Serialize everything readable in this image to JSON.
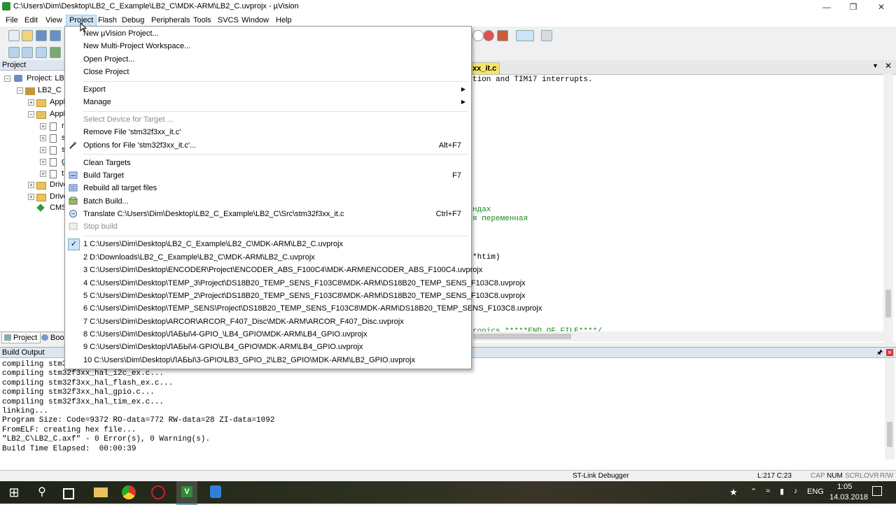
{
  "window": {
    "title": "C:\\Users\\Dim\\Desktop\\LB2_C_Example\\LB2_C\\MDK-ARM\\LB2_C.uvprojx - µVision"
  },
  "menubar": [
    "File",
    "Edit",
    "View",
    "Project",
    "Flash",
    "Debug",
    "Peripherals",
    "Tools",
    "SVCS",
    "Window",
    "Help"
  ],
  "project_pane": {
    "header": "Project",
    "tree": [
      "Project: LB2_",
      "LB2_C",
      "Appl",
      "Appl",
      "r",
      "s",
      "s",
      "g",
      "t",
      "Drive",
      "Drive",
      "CMS"
    ],
    "tabs": [
      "Project",
      "Boo"
    ]
  },
  "editor": {
    "tab": "xx_it.c",
    "lines": [
      {
        "text": "tion and TIM17 interrupts.",
        "color": "black"
      },
      {
        "text": "ндах",
        "color": "green"
      },
      {
        "text": "я переменная",
        "color": "green"
      },
      {
        "text": "*htim)",
        "color": "black"
      },
      {
        "text": "ronics *****END OF FILE****/",
        "color": "green"
      }
    ]
  },
  "project_menu": {
    "items": [
      {
        "label": "New µVision Project...",
        "shortcut": "",
        "enabled": true
      },
      {
        "label": "New Multi-Project Workspace...",
        "shortcut": "",
        "enabled": true
      },
      {
        "label": "Open Project...",
        "shortcut": "",
        "enabled": true
      },
      {
        "label": "Close Project",
        "shortcut": "",
        "enabled": true
      },
      {
        "label": "Export",
        "shortcut": "",
        "enabled": true,
        "submenu": true
      },
      {
        "label": "Manage",
        "shortcut": "",
        "enabled": true,
        "submenu": true
      },
      {
        "label": "Select Device for Target ...",
        "shortcut": "",
        "enabled": false
      },
      {
        "label": "Remove File 'stm32f3xx_it.c'",
        "shortcut": "",
        "enabled": true
      },
      {
        "label": "Options for File 'stm32f3xx_it.c'...",
        "shortcut": "Alt+F7",
        "enabled": true,
        "icon": "options-wand-icon"
      },
      {
        "label": "Clean Targets",
        "shortcut": "",
        "enabled": true
      },
      {
        "label": "Build Target",
        "shortcut": "F7",
        "enabled": true,
        "icon": "build-icon"
      },
      {
        "label": "Rebuild all target files",
        "shortcut": "",
        "enabled": true,
        "icon": "rebuild-icon"
      },
      {
        "label": "Batch Build...",
        "shortcut": "",
        "enabled": true,
        "icon": "batch-build-icon"
      },
      {
        "label": "Translate C:\\Users\\Dim\\Desktop\\LB2_C_Example\\LB2_C\\Src\\stm32f3xx_it.c",
        "shortcut": "Ctrl+F7",
        "enabled": true,
        "icon": "translate-icon"
      },
      {
        "label": "Stop build",
        "shortcut": "",
        "enabled": false,
        "icon": "stop-build-icon"
      }
    ],
    "recent": [
      "1 C:\\Users\\Dim\\Desktop\\LB2_C_Example\\LB2_C\\MDK-ARM\\LB2_C.uvprojx",
      "2 D:\\Downloads\\LB2_C_Example\\LB2_C\\MDK-ARM\\LB2_C.uvprojx",
      "3 C:\\Users\\Dim\\Desktop\\ENCODER\\Project\\ENCODER_ABS_F100C4\\MDK-ARM\\ENCODER_ABS_F100C4.uvprojx",
      "4 C:\\Users\\Dim\\Desktop\\TEMP_3\\Project\\DS18B20_TEMP_SENS_F103C8\\MDK-ARM\\DS18B20_TEMP_SENS_F103C8.uvprojx",
      "5 C:\\Users\\Dim\\Desktop\\TEMP_2\\Project\\DS18B20_TEMP_SENS_F103C8\\MDK-ARM\\DS18B20_TEMP_SENS_F103C8.uvprojx",
      "6 C:\\Users\\Dim\\Desktop\\TEMP_SENS\\Project\\DS18B20_TEMP_SENS_F103C8\\MDK-ARM\\DS18B20_TEMP_SENS_F103C8.uvprojx",
      "7 C:\\Users\\Dim\\Desktop\\ARCOR\\ARCOR_F407_Disc\\MDK-ARM\\ARCOR_F407_Disc.uvprojx",
      "8 C:\\Users\\Dim\\Desktop\\ЛАБЫ\\4-GPIO_\\LB4_GPIO\\MDK-ARM\\LB4_GPIO.uvprojx",
      "9 C:\\Users\\Dim\\Desktop\\ЛАБЫ\\4-GPIO\\LB4_GPIO\\MDK-ARM\\LB4_GPIO.uvprojx",
      "10 C:\\Users\\Dim\\Desktop\\ЛАБЫ\\3-GPIO\\LB3_GPIO_2\\LB2_GPIO\\MDK-ARM\\LB2_GPIO.uvprojx"
    ]
  },
  "build_output": {
    "header": "Build Output",
    "lines": [
      "compiling stm32f3xx_hal_i2c.c...",
      "compiling stm32f3xx_hal_i2c_ex.c...",
      "compiling stm32f3xx_hal_flash_ex.c...",
      "compiling stm32f3xx_hal_gpio.c...",
      "compiling stm32f3xx_hal_tim_ex.c...",
      "linking...",
      "Program Size: Code=9372 RO-data=772 RW-data=28 ZI-data=1092",
      "FromELF: creating hex file...",
      "\"LB2_C\\LB2_C.axf\" - 0 Error(s), 0 Warning(s).",
      "Build Time Elapsed:  00:00:39"
    ]
  },
  "statusbar": {
    "debugger": "ST-Link Debugger",
    "position": "L:217 C:23",
    "indicators": [
      "CAP",
      "NUM",
      "SCRL",
      "OVR",
      "R/W"
    ]
  },
  "taskbar": {
    "lang": "ENG",
    "time": "1:05",
    "date": "14.03.2018"
  }
}
